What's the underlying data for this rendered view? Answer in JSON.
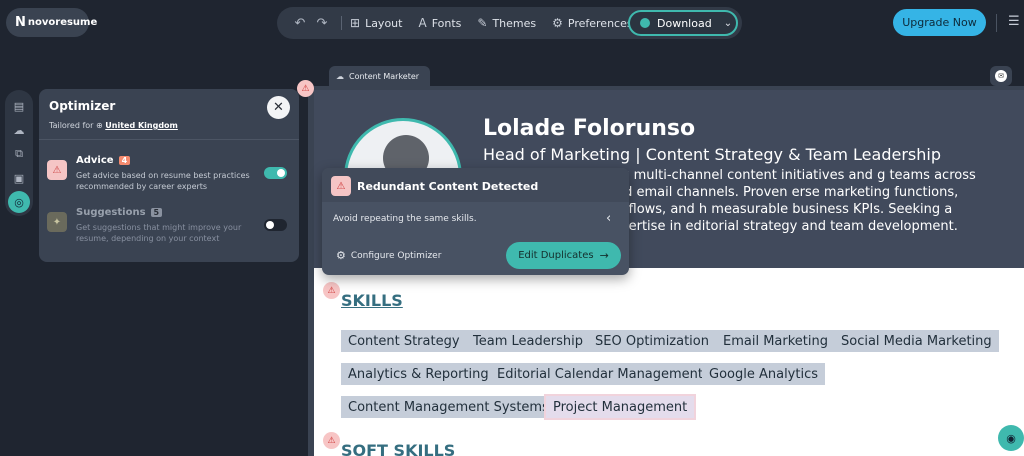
{
  "brand": {
    "name": "novoresume",
    "mark": "N"
  },
  "toolbar": {
    "undo_icon": "↶",
    "redo_icon": "↷",
    "layout": "Layout",
    "fonts": "Fonts",
    "themes": "Themes",
    "preferences": "Preferences",
    "download": "Download",
    "upgrade": "Upgrade Now",
    "menu_icon": "☰"
  },
  "optimizer": {
    "title": "Optimizer",
    "tailored_prefix": "Tailored for",
    "country": "United Kingdom",
    "advice": {
      "title": "Advice",
      "count": "4",
      "description": "Get advice based on resume best practices recommended by career experts",
      "enabled": true
    },
    "suggestions": {
      "title": "Suggestions",
      "count": "5",
      "description": "Get suggestions that might improve your resume, depending on your context",
      "enabled": false
    }
  },
  "editor": {
    "tab_label": "Content Marketer"
  },
  "resume": {
    "name": "Lolade Folorunso",
    "role": "Head of Marketing | Content Strategy & Team Leadership",
    "summary": "er with 3 years driving multi-channel content initiatives and g teams across SEO, social media, and email channels. Proven erse marketing functions, optimize content workflows, and h measurable business KPIs. Seeking a content-focused n expertise in editorial strategy and team development.",
    "skills_heading": "SKILLS",
    "skills": [
      "Content Strategy",
      "Team Leadership",
      "SEO Optimization",
      "Email Marketing",
      "Social Media Marketing",
      "Analytics & Reporting",
      "Editorial Calendar Management",
      "Google Analytics",
      "Content Management Systems",
      "Project Management"
    ],
    "soft_skills_heading": "SOFT SKILLS"
  },
  "popover": {
    "title": "Redundant Content Detected",
    "description": "Avoid repeating the same skills.",
    "configure": "Configure Optimizer",
    "action": "Edit Duplicates"
  },
  "colors": {
    "accent": "#3fb9ae",
    "upgrade": "#35b4e6",
    "heading": "#356e80",
    "warning": "#f5c5c5"
  }
}
